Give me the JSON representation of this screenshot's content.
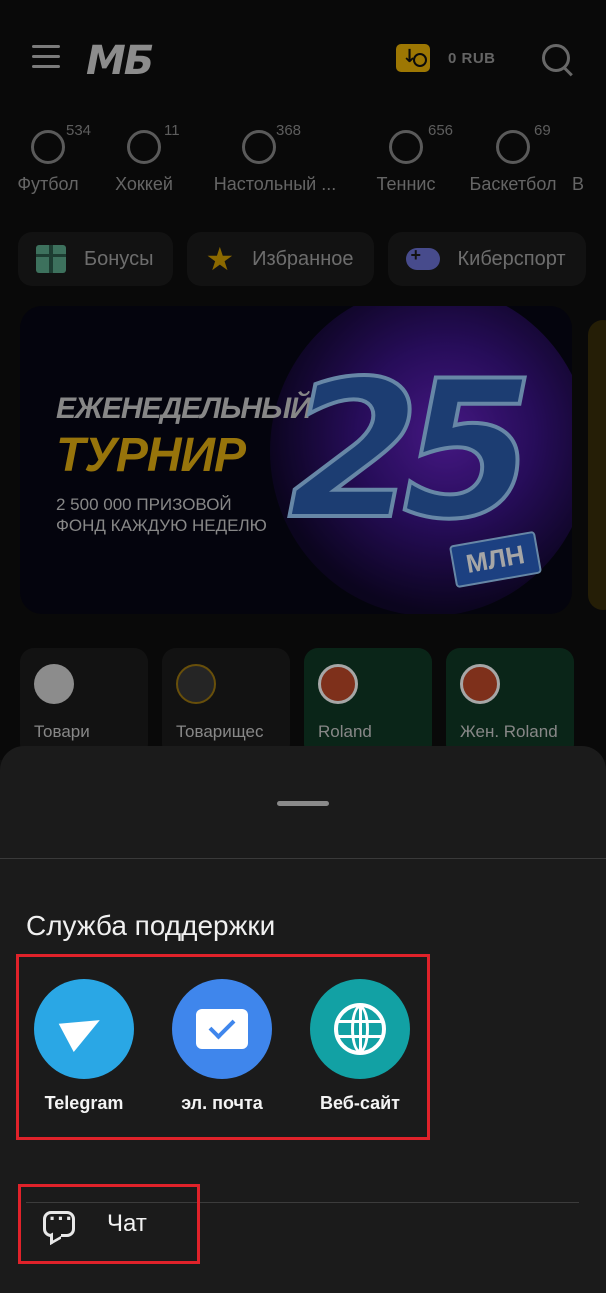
{
  "header": {
    "logo": "МБ",
    "balance": "0 RUB"
  },
  "sports": [
    {
      "label": "Футбол",
      "count": "534",
      "icon": "soccer-ball-icon"
    },
    {
      "label": "Хоккей",
      "count": "11",
      "icon": "hockey-puck-icon"
    },
    {
      "label": "Настольный ...",
      "count": "368",
      "icon": "table-tennis-icon"
    },
    {
      "label": "Теннис",
      "count": "656",
      "icon": "tennis-ball-icon"
    },
    {
      "label": "Баскетбол",
      "count": "69",
      "icon": "basketball-icon"
    },
    {
      "label": "В",
      "count": "",
      "icon": "sport-icon"
    }
  ],
  "chips": [
    {
      "label": "Бонусы",
      "icon": "gift-icon"
    },
    {
      "label": "Избранное",
      "icon": "star-icon"
    },
    {
      "label": "Киберспорт",
      "icon": "gamepad-icon"
    }
  ],
  "banner": {
    "line1": "ЕЖЕНЕДЕЛЬНЫЙ",
    "line2": "ТУРНИР",
    "line3": "2 500 000 ПРИЗОВОЙ ФОНД КАЖДУЮ НЕДЕЛЮ",
    "big_number": "25",
    "unit": "МЛН"
  },
  "leagues": [
    {
      "name": "Товари",
      "style": "dark"
    },
    {
      "name": "Товарищес",
      "style": "dark"
    },
    {
      "name": "Roland",
      "style": "green"
    },
    {
      "name": "Жен. Roland",
      "style": "green"
    }
  ],
  "support": {
    "title": "Служба поддержки",
    "contacts": [
      {
        "label": "Telegram",
        "icon": "telegram-icon",
        "color": "#2aa7e5"
      },
      {
        "label": "эл. почта",
        "icon": "mail-icon",
        "color": "#3f86ec"
      },
      {
        "label": "Веб-сайт",
        "icon": "globe-icon",
        "color": "#12a1a4"
      }
    ],
    "chat_label": "Чат"
  },
  "colors": {
    "accent": "#f2b705",
    "highlight_border": "#e0222a"
  }
}
